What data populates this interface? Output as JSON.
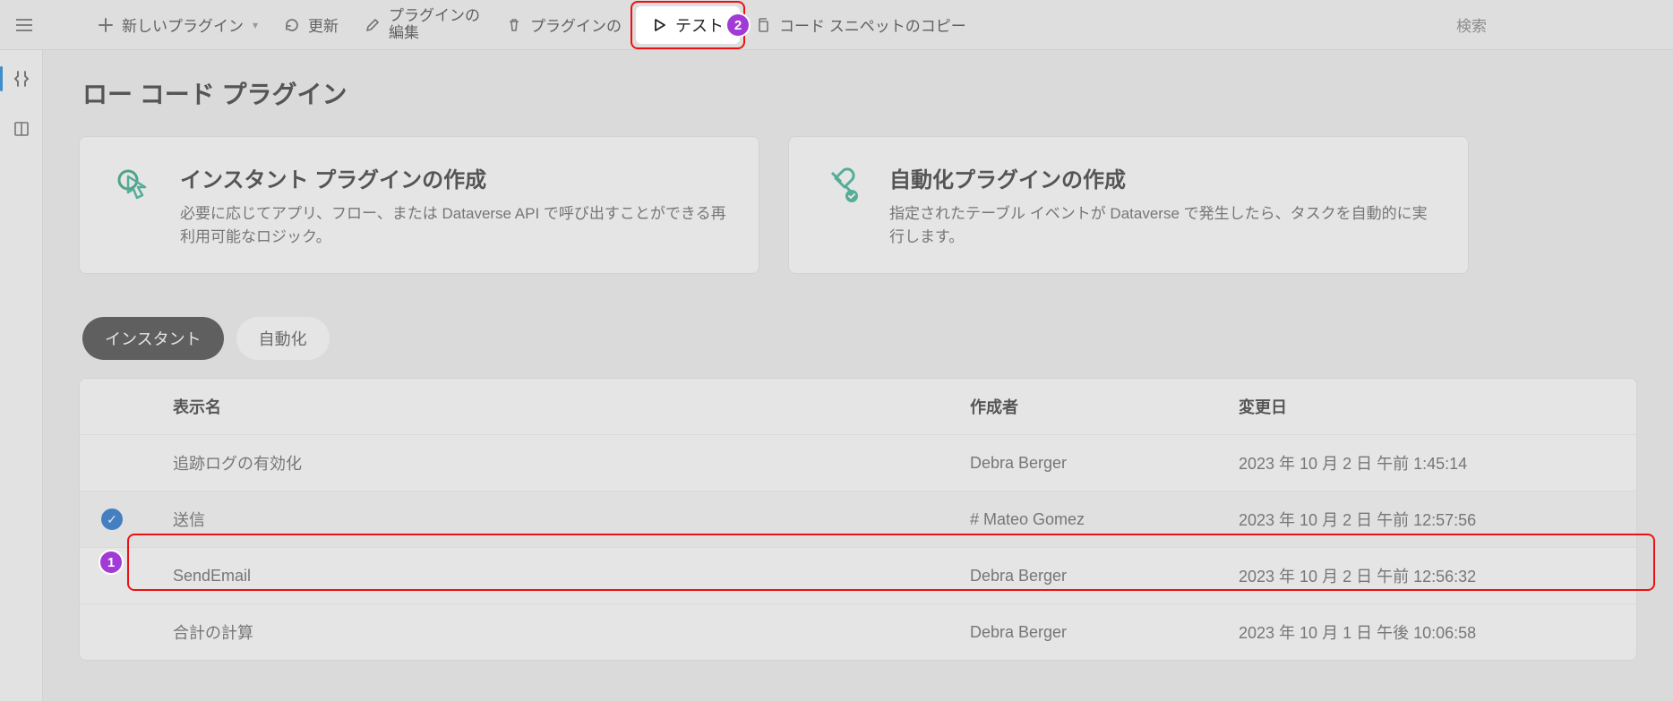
{
  "toolbar": {
    "new_plugin": "新しいプラグイン",
    "refresh": "更新",
    "edit_plugin_line1": "プラグインの",
    "edit_plugin_line2": "編集",
    "delete_plugin_partial": "プラグインの",
    "test": "テスト",
    "copy_snippet": "コード スニペットのコピー",
    "search_placeholder": "検索"
  },
  "page": {
    "title": "ロー コード プラグイン"
  },
  "cards": {
    "instant": {
      "title": "インスタント プラグインの作成",
      "desc": "必要に応じてアプリ、フロー、または Dataverse API で呼び出すことができる再利用可能なロジック。"
    },
    "automated": {
      "title": "自動化プラグインの作成",
      "desc": "指定されたテーブル イベントが Dataverse で発生したら、タスクを自動的に実行します。"
    }
  },
  "tabs": {
    "instant": "インスタント",
    "automated": "自動化"
  },
  "grid": {
    "col_display_name": "表示名",
    "col_created_by": "作成者",
    "col_modified": "変更日",
    "rows": [
      {
        "name": "追跡ログの有効化",
        "author": "Debra Berger",
        "modified": "2023 年 10 月 2 日 午前 1:45:14",
        "selected": false
      },
      {
        "name": "送信",
        "author": "# Mateo Gomez",
        "modified": "2023 年 10 月 2 日 午前 12:57:56",
        "selected": true
      },
      {
        "name": "SendEmail",
        "author": "Debra Berger",
        "modified": "2023 年 10 月 2 日 午前 12:56:32",
        "selected": false
      },
      {
        "name": "合計の計算",
        "author": "Debra Berger",
        "modified": "2023 年 10 月 1 日 午後 10:06:58",
        "selected": false
      }
    ]
  },
  "callouts": {
    "one": "1",
    "two": "2"
  }
}
